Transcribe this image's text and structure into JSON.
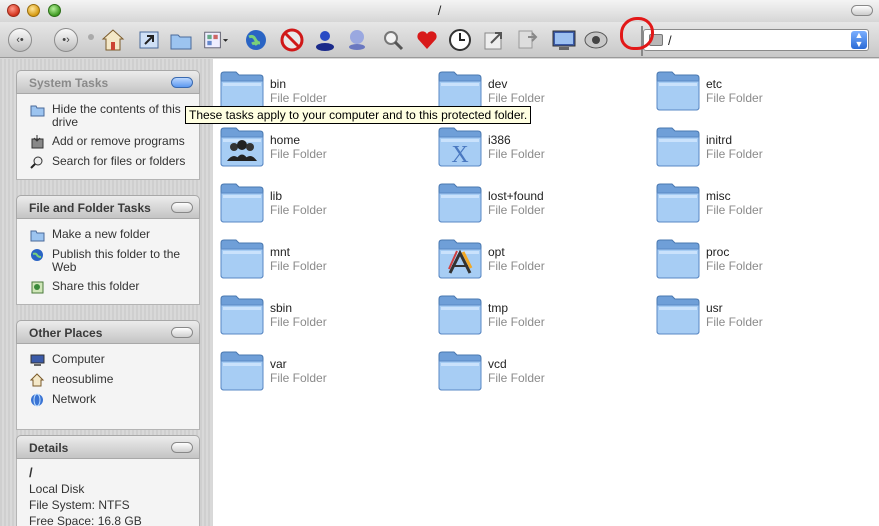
{
  "window": {
    "title": "/"
  },
  "toolbar": {
    "buttons": [
      {
        "name": "back-button",
        "icon": "back-arrow-icon"
      },
      {
        "name": "forward-button",
        "icon": "forward-arrow-icon"
      },
      {
        "name": "home-button",
        "icon": "home-icon"
      },
      {
        "name": "up-button",
        "icon": "up-folder-icon"
      },
      {
        "name": "folders-button",
        "icon": "folders-icon"
      },
      {
        "name": "views-button",
        "icon": "views-icon"
      },
      {
        "name": "network-button",
        "icon": "globe-icon"
      },
      {
        "name": "stop-button",
        "icon": "stop-icon"
      },
      {
        "name": "user-button",
        "icon": "user-icon"
      },
      {
        "name": "user2-button",
        "icon": "user-faded-icon"
      },
      {
        "name": "search-button",
        "icon": "magnifier-icon"
      },
      {
        "name": "favorites-button",
        "icon": "heart-icon"
      },
      {
        "name": "history-button",
        "icon": "clock-icon"
      },
      {
        "name": "move-to-button",
        "icon": "move-to-icon"
      },
      {
        "name": "copy-to-button",
        "icon": "copy-to-icon"
      },
      {
        "name": "computer-button",
        "icon": "monitor-icon"
      },
      {
        "name": "drive-button",
        "icon": "drive-icon"
      }
    ]
  },
  "address": {
    "value": "/"
  },
  "tooltip": "These tasks apply to your computer and to this protected folder.",
  "sidebar": {
    "system_tasks": {
      "title": "System Tasks",
      "items": [
        {
          "label": "Hide the contents of this drive",
          "icon": "folder-icon"
        },
        {
          "label": "Add or remove programs",
          "icon": "install-icon"
        },
        {
          "label": "Search for files or folders",
          "icon": "search-icon"
        }
      ]
    },
    "file_folder_tasks": {
      "title": "File and Folder Tasks",
      "items": [
        {
          "label": "Make a new folder",
          "icon": "new-folder-icon"
        },
        {
          "label": "Publish this folder to the Web",
          "icon": "globe-icon"
        },
        {
          "label": "Share this folder",
          "icon": "share-icon"
        }
      ]
    },
    "other_places": {
      "title": "Other Places",
      "items": [
        {
          "label": "Computer",
          "icon": "computer-icon"
        },
        {
          "label": "neosublime",
          "icon": "home-icon"
        },
        {
          "label": "Network",
          "icon": "network-icon"
        }
      ]
    },
    "details": {
      "title": "Details",
      "name": "/",
      "kind": "Local Disk",
      "filesystem": "File System: NTFS",
      "free_space": "Free Space: 16.8 GB"
    }
  },
  "files": [
    {
      "name": "bin",
      "type": "File Folder",
      "icon": "folder-icon"
    },
    {
      "name": "dev",
      "type": "File Folder",
      "icon": "folder-icon"
    },
    {
      "name": "etc",
      "type": "File Folder",
      "icon": "folder-icon"
    },
    {
      "name": "home",
      "type": "File Folder",
      "icon": "users-folder-icon"
    },
    {
      "name": "i386",
      "type": "File Folder",
      "icon": "x-folder-icon"
    },
    {
      "name": "initrd",
      "type": "File Folder",
      "icon": "folder-icon"
    },
    {
      "name": "lib",
      "type": "File Folder",
      "icon": "folder-icon"
    },
    {
      "name": "lost+found",
      "type": "File Folder",
      "icon": "folder-icon"
    },
    {
      "name": "misc",
      "type": "File Folder",
      "icon": "folder-icon"
    },
    {
      "name": "mnt",
      "type": "File Folder",
      "icon": "folder-icon"
    },
    {
      "name": "opt",
      "type": "File Folder",
      "icon": "applications-folder-icon"
    },
    {
      "name": "proc",
      "type": "File Folder",
      "icon": "folder-icon"
    },
    {
      "name": "sbin",
      "type": "File Folder",
      "icon": "folder-icon"
    },
    {
      "name": "tmp",
      "type": "File Folder",
      "icon": "folder-icon"
    },
    {
      "name": "usr",
      "type": "File Folder",
      "icon": "folder-icon"
    },
    {
      "name": "var",
      "type": "File Folder",
      "icon": "folder-icon"
    },
    {
      "name": "vcd",
      "type": "File Folder",
      "icon": "folder-icon"
    }
  ],
  "colors": {
    "folder": "#8fbbee",
    "accent": "#e21818",
    "tooltip_bg": "#ffffe1"
  }
}
